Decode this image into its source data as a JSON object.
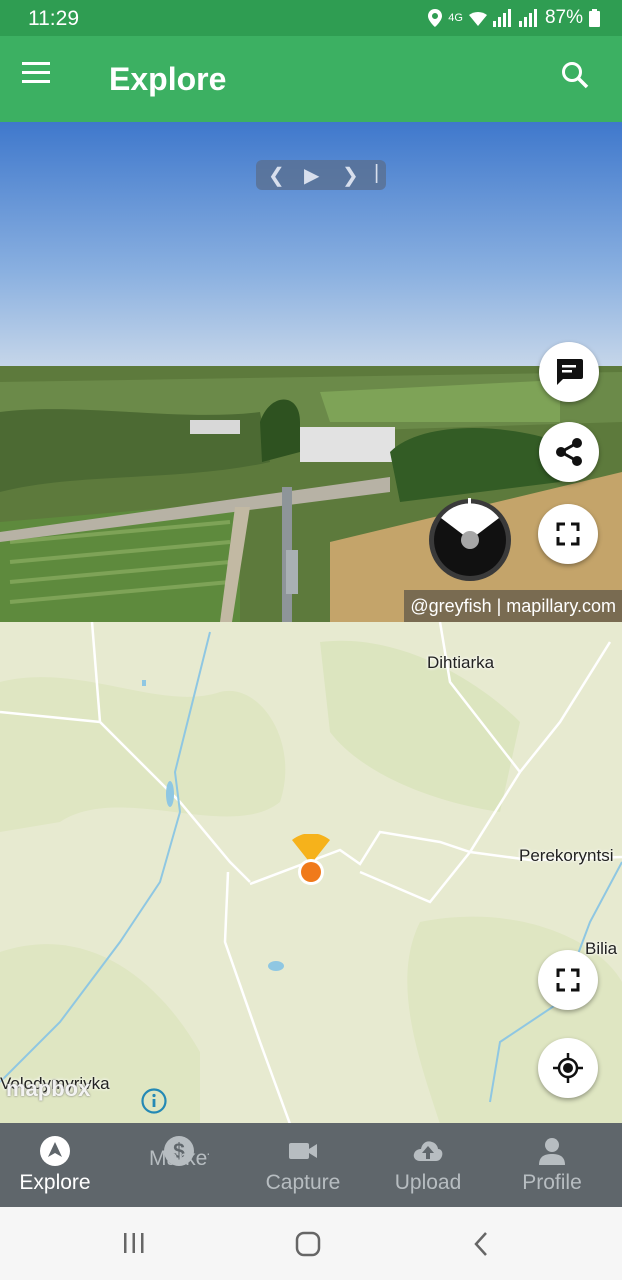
{
  "status_bar": {
    "time": "11:29",
    "network": "4G",
    "battery": "87%"
  },
  "app_bar": {
    "title": "Explore",
    "menu_icon": "menu-icon",
    "search_icon": "search-icon"
  },
  "viewer": {
    "attribution": "@greyfish | mapillary.com",
    "actions": [
      "comment-icon",
      "share-icon",
      "fullscreen-icon"
    ]
  },
  "map": {
    "labels": {
      "dihtiarka": "Dihtiarka",
      "perekoryntsi": "Perekoryntsi",
      "bilia": "Bilia",
      "volodymyrivka": "Volodymyrivka"
    },
    "logo": "mapbox",
    "actions": [
      "fullscreen-icon",
      "locate-icon",
      "info-icon"
    ]
  },
  "bottom_nav": {
    "items": [
      {
        "label": "Explore",
        "icon": "explore-icon",
        "active": true
      },
      {
        "label": "Marketplace",
        "icon": "dollar-icon",
        "active": false
      },
      {
        "label": "Capture",
        "icon": "camera-icon",
        "active": false
      },
      {
        "label": "Upload",
        "icon": "upload-icon",
        "active": false
      },
      {
        "label": "Profile",
        "icon": "profile-icon",
        "active": false
      }
    ]
  },
  "colors": {
    "primary": "#3cb062",
    "status_bar": "#2f9d52",
    "nav_bg": "#5f666b",
    "marker": "#f07a1a",
    "marker_cone": "#f6b21b"
  }
}
